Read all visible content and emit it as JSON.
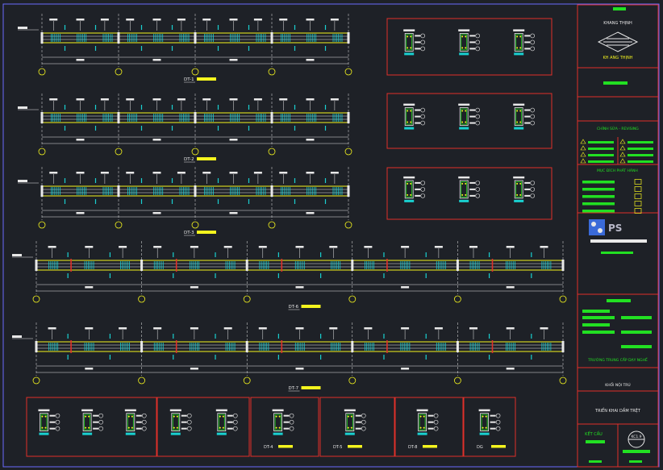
{
  "colors": {
    "background": "#1e2127",
    "border": "#6a6aff",
    "red": "#e0302a",
    "yellow": "#f5f51e",
    "green": "#22e022",
    "cyan": "#19d0d0",
    "white": "#e8e8e8"
  },
  "beams": [
    {
      "label": "DT-1",
      "spans": 4
    },
    {
      "label": "DT-2",
      "spans": 4
    },
    {
      "label": "DT-3",
      "spans": 4
    },
    {
      "label": "DT-6",
      "spans": 5
    },
    {
      "label": "DT-7",
      "spans": 5
    }
  ],
  "bottom_details": [
    {
      "label": "DT-4"
    },
    {
      "label": "DT-5"
    },
    {
      "label": "DT-8"
    },
    {
      "label": "DG"
    }
  ],
  "title_block": {
    "company_top": "KHANG THỊNH",
    "company_bottom": "KH ANG THỊNH",
    "revision_header": "CHỈNH SỬA - REVISING",
    "purpose_header": "MỤC ĐÍCH PHÁT HÀNH",
    "logo_text": "PS",
    "school": "TRƯỜNG TRUNG CẤP DẠY NGHỀ",
    "block_name": "KHỐI NỘI TRÚ",
    "drawing_title": "TRIỂN KHAI DẦM TRỆT",
    "discipline": "KẾT CẤU",
    "sheet_no": "KC1.9"
  }
}
